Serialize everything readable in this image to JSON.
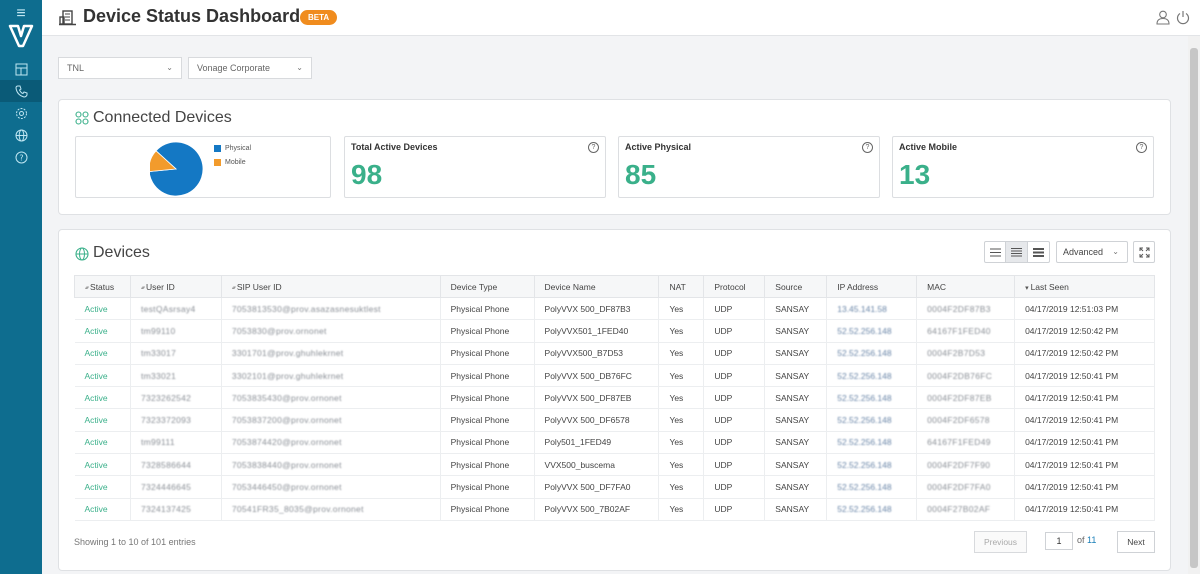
{
  "header": {
    "title": "Device Status Dashboard",
    "badge": "BETA"
  },
  "filters": {
    "account": "TNL",
    "company": "Vonage Corporate"
  },
  "connected_devices": {
    "title": "Connected Devices",
    "chart_data": {
      "type": "pie",
      "categories": [
        "Physical",
        "Mobile"
      ],
      "values": [
        85,
        13
      ],
      "colors": [
        "#1478c4",
        "#f29b2c"
      ],
      "legend": "right"
    },
    "cards": [
      {
        "label": "Total Active Devices",
        "value": "98"
      },
      {
        "label": "Active Physical",
        "value": "85"
      },
      {
        "label": "Active Mobile",
        "value": "13"
      }
    ]
  },
  "devices": {
    "title": "Devices",
    "advanced_label": "Advanced",
    "columns": [
      "Status",
      "User ID",
      "SIP User ID",
      "Device Type",
      "Device Name",
      "NAT",
      "Protocol",
      "Source",
      "IP Address",
      "MAC",
      "Last Seen"
    ],
    "rows": [
      [
        "Active",
        "testQAsrsay4",
        "7053813530@prov.asazasnesuktlest",
        "Physical Phone",
        "PolyVVX 500_DF87B3",
        "Yes",
        "UDP",
        "SANSAY",
        "13.45.141.58",
        "0004F2DF87B3",
        "04/17/2019 12:51:03 PM"
      ],
      [
        "Active",
        "tm99110",
        "7053830@prov.ornonet",
        "Physical Phone",
        "PolyVVX501_1FED40",
        "Yes",
        "UDP",
        "SANSAY",
        "52.52.256.148",
        "64167F1FED40",
        "04/17/2019 12:50:42 PM"
      ],
      [
        "Active",
        "tm33017",
        "3301701@prov.ghuhlekrnet",
        "Physical Phone",
        "PolyVVX500_B7D53",
        "Yes",
        "UDP",
        "SANSAY",
        "52.52.256.148",
        "0004F2B7D53",
        "04/17/2019 12:50:42 PM"
      ],
      [
        "Active",
        "tm33021",
        "3302101@prov.ghuhlekrnet",
        "Physical Phone",
        "PolyVVX 500_DB76FC",
        "Yes",
        "UDP",
        "SANSAY",
        "52.52.256.148",
        "0004F2DB76FC",
        "04/17/2019 12:50:41 PM"
      ],
      [
        "Active",
        "7323262542",
        "7053835430@prov.ornonet",
        "Physical Phone",
        "PolyVVX 500_DF87EB",
        "Yes",
        "UDP",
        "SANSAY",
        "52.52.256.148",
        "0004F2DF87EB",
        "04/17/2019 12:50:41 PM"
      ],
      [
        "Active",
        "7323372093",
        "7053837200@prov.ornonet",
        "Physical Phone",
        "PolyVVX 500_DF6578",
        "Yes",
        "UDP",
        "SANSAY",
        "52.52.256.148",
        "0004F2DF6578",
        "04/17/2019 12:50:41 PM"
      ],
      [
        "Active",
        "tm99111",
        "7053874420@prov.ornonet",
        "Physical Phone",
        "Poly501_1FED49",
        "Yes",
        "UDP",
        "SANSAY",
        "52.52.256.148",
        "64167F1FED49",
        "04/17/2019 12:50:41 PM"
      ],
      [
        "Active",
        "7328586644",
        "7053838440@prov.ornonet",
        "Physical Phone",
        "VVX500_buscema",
        "Yes",
        "UDP",
        "SANSAY",
        "52.52.256.148",
        "0004F2DF7F90",
        "04/17/2019 12:50:41 PM"
      ],
      [
        "Active",
        "7324446645",
        "7053446450@prov.ornonet",
        "Physical Phone",
        "PolyVVX 500_DF7FA0",
        "Yes",
        "UDP",
        "SANSAY",
        "52.52.256.148",
        "0004F2DF7FA0",
        "04/17/2019 12:50:41 PM"
      ],
      [
        "Active",
        "7324137425",
        "70541FR35_8035@prov.ornonet",
        "Physical Phone",
        "PolyVVX 500_7B02AF",
        "Yes",
        "UDP",
        "SANSAY",
        "52.52.256.148",
        "0004F27B02AF",
        "04/17/2019 12:50:41 PM"
      ]
    ]
  },
  "pagination": {
    "showing": "Showing 1 to 10 of 101 entries",
    "previous": "Previous",
    "page": "1",
    "of_label": "of",
    "total_pages": "11",
    "next": "Next"
  }
}
